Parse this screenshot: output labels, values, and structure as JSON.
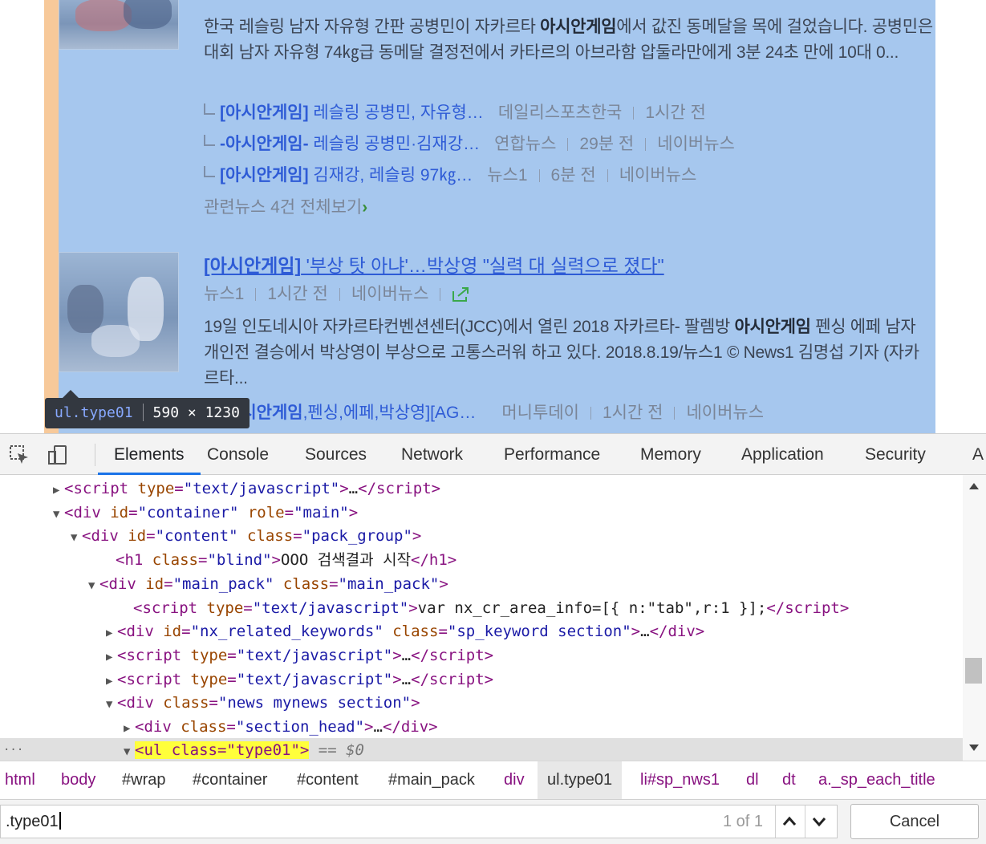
{
  "page": {
    "article1": {
      "summary_pre": "한국 레슬링 남자 자유형 간판 공병민이 자카르타 ",
      "summary_bold": "아시안게임",
      "summary_post": "에서 값진 동메달을 목에 걸었습니다. 공병민은 대회 남자 자유형 74㎏급 동메달 결정전에서 카타르의 아브라함 압둘라만에게 3분 24초 만에 10대 0...",
      "related": [
        {
          "title_bold": "[아시안게임]",
          "title_rest": " 레슬링 공병민, 자유형…",
          "meta": [
            "데일리스포츠한국",
            "1시간 전"
          ]
        },
        {
          "title_bold": "-아시안게임-",
          "title_rest": " 레슬링 공병민·김재강…",
          "meta": [
            "연합뉴스",
            "29분 전",
            "네이버뉴스"
          ]
        },
        {
          "title_bold": "[아시안게임]",
          "title_rest": " 김재강, 레슬링 97㎏…",
          "meta": [
            "뉴스1",
            "6분 전",
            "네이버뉴스"
          ]
        }
      ],
      "more_text": "관련뉴스 4건 전체보기",
      "more_arrow": "›"
    },
    "article2": {
      "title_bold": "[아시안게임]",
      "title_rest": " '부상 탓 아냐'…박상영 \"실력 대 실력으로 졌다\"",
      "meta": [
        "뉴스1",
        "1시간 전",
        "네이버뉴스"
      ],
      "summary_pre": "19일 인도네시아 자카르타컨벤션센터(JCC)에서 열린 2018 자카르타- 팔렘방 ",
      "summary_bold": "아시안게임",
      "summary_post": " 펜싱 에페 남자 개인전 결승에서 박상영이 부상으로 고통스러워 하고 있다. 2018.8.19/뉴스1 © News1 김명섭 기자 (자카르타...",
      "related_title_bold": "[아시안게임",
      "related_title_rest": ",펜싱,에페,박상영][AG…",
      "related_meta": [
        "머니투데이",
        "1시간 전",
        "네이버뉴스"
      ]
    },
    "tooltip": {
      "selector": "ul.type01",
      "size": "590 × 1230"
    }
  },
  "devtools": {
    "tabs": [
      "Elements",
      "Console",
      "Sources",
      "Network",
      "Performance",
      "Memory",
      "Application",
      "Security",
      "A"
    ],
    "active_tab": "Elements",
    "dom_lines": [
      {
        "tag": "script",
        "attrs": [
          [
            "type",
            "text/javascript"
          ]
        ],
        "text": "…",
        "close": true,
        "tri": "▶"
      },
      {
        "tag": "div",
        "attrs": [
          [
            "id",
            "container"
          ],
          [
            "role",
            "main"
          ]
        ],
        "tri": "▼"
      },
      {
        "tag": "div",
        "attrs": [
          [
            "id",
            "content"
          ],
          [
            "class",
            "pack_group"
          ]
        ],
        "tri": "▼"
      },
      {
        "tag": "h1",
        "attrs": [
          [
            "class",
            "blind"
          ]
        ],
        "text": "OOO 검색결과 시작",
        "close": true,
        "tri": ""
      },
      {
        "tag": "div",
        "attrs": [
          [
            "id",
            "main_pack"
          ],
          [
            "class",
            "main_pack"
          ]
        ],
        "tri": "▼"
      },
      {
        "tag": "script",
        "attrs": [
          [
            "type",
            "text/javascript"
          ]
        ],
        "text": "var nx_cr_area_info=[{ n:\"tab\",r:1 }];",
        "close": true,
        "tri": ""
      },
      {
        "tag": "div",
        "attrs": [
          [
            "id",
            "nx_related_keywords"
          ],
          [
            "class",
            "sp_keyword section"
          ]
        ],
        "text": "…",
        "close": true,
        "tri": "▶"
      },
      {
        "tag": "script",
        "attrs": [
          [
            "type",
            "text/javascript"
          ]
        ],
        "text": "…",
        "close": true,
        "tri": "▶"
      },
      {
        "tag": "script",
        "attrs": [
          [
            "type",
            "text/javascript"
          ]
        ],
        "text": "…",
        "close": true,
        "tri": "▶"
      },
      {
        "tag": "div",
        "attrs": [
          [
            "class",
            "news mynews section"
          ]
        ],
        "tri": "▼"
      },
      {
        "tag": "div",
        "attrs": [
          [
            "class",
            "section_head"
          ]
        ],
        "text": "…",
        "close": true,
        "tri": "▶"
      }
    ],
    "selected_line": {
      "text": "<ul class=\"type01\">",
      "suffix": "== $0",
      "tri": "▼",
      "dots": "..."
    },
    "breadcrumbs": [
      "html",
      "body",
      "#wrap",
      "#container",
      "#content",
      "#main_pack",
      "div",
      "ul.type01",
      "li#sp_nws1",
      "dl",
      "dt",
      "a._sp_each_title"
    ],
    "active_crumb": "ul.type01",
    "search": {
      "query": ".type01",
      "count": "1 of 1",
      "cancel": "Cancel"
    }
  },
  "colors": {
    "highlight": "#a6c7ee",
    "padding": "#f7c99a",
    "link": "#2e5bd6",
    "devtools_tag": "#881280",
    "devtools_attr": "#994500",
    "devtools_value": "#1a1aa6",
    "active_tab_underline": "#1a73e8"
  }
}
